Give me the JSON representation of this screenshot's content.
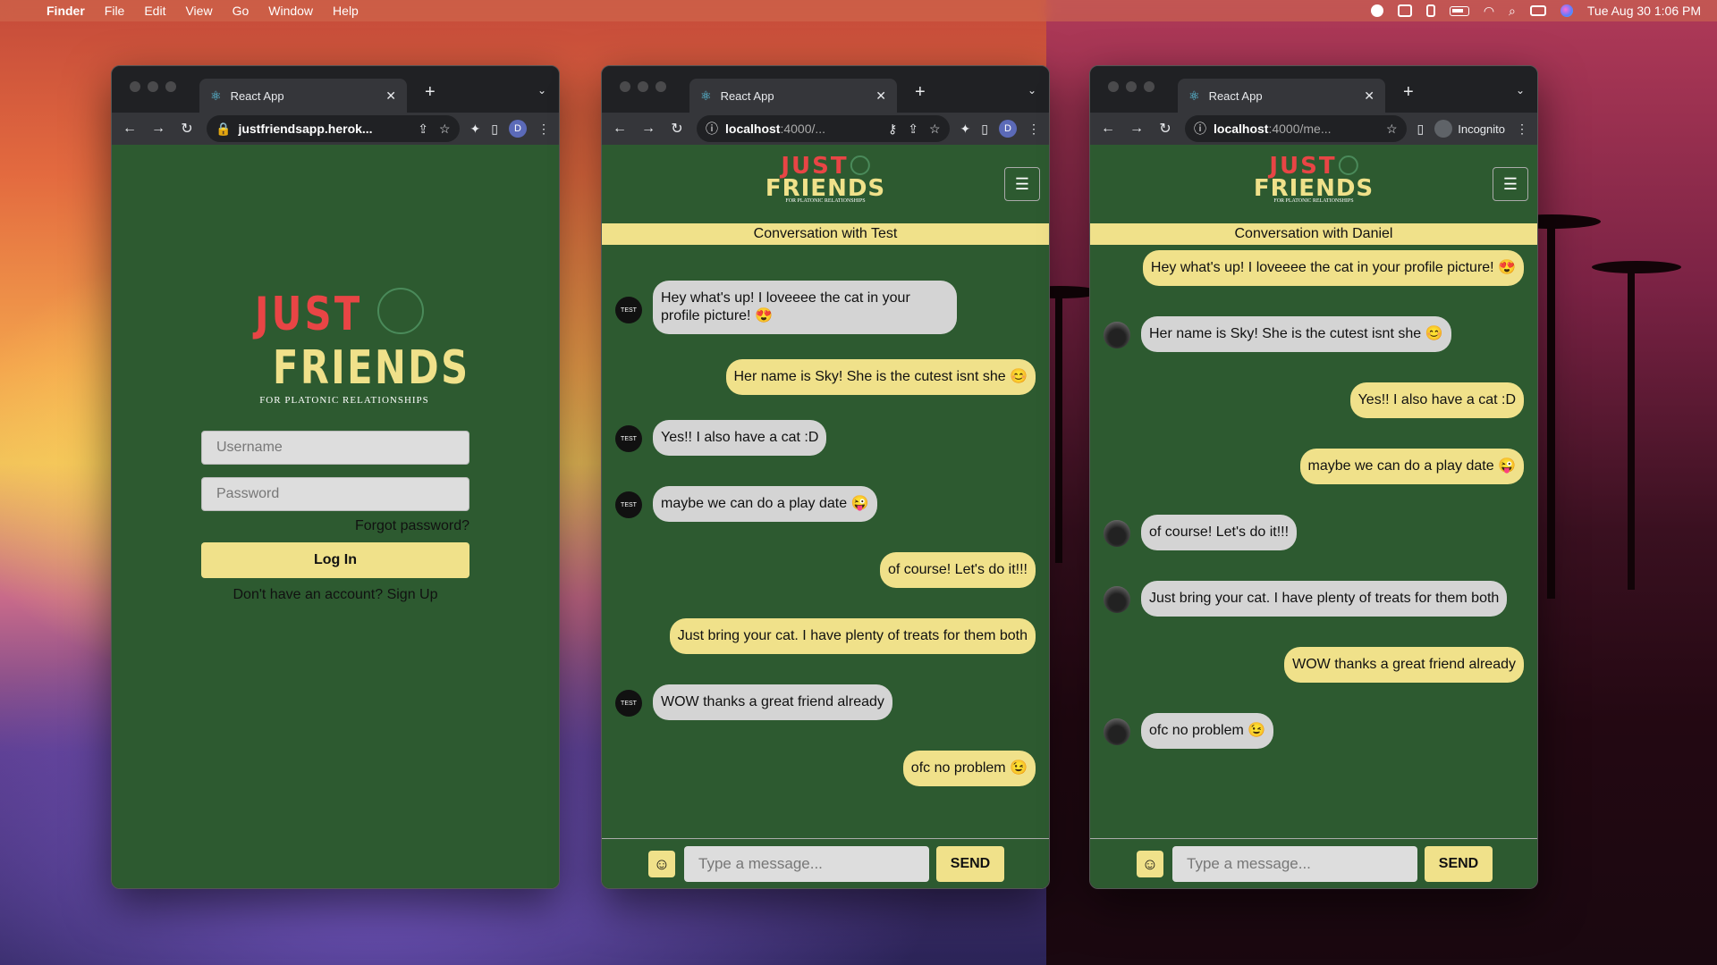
{
  "menubar": {
    "app": "Finder",
    "menus": [
      "File",
      "Edit",
      "View",
      "Go",
      "Window",
      "Help"
    ],
    "datetime": "Tue Aug 30  1:06 PM"
  },
  "windows": [
    {
      "tab_title": "React App",
      "url_host": "justfriendsapp.herok...",
      "url_path": "",
      "profile_initial": "D"
    },
    {
      "tab_title": "React App",
      "url_host": "localhost",
      "url_path": ":4000/...",
      "profile_initial": "D"
    },
    {
      "tab_title": "React App",
      "url_host": "localhost",
      "url_path": ":4000/me...",
      "incognito_label": "Incognito"
    }
  ],
  "logo": {
    "just": "JUST",
    "friends": "FRIENDS",
    "tagline": "FOR PLATONIC RELATIONSHIPS"
  },
  "login": {
    "username_placeholder": "Username",
    "password_placeholder": "Password",
    "forgot": "Forgot password?",
    "login_button": "Log In",
    "signup": "Don't have an account? Sign Up"
  },
  "chat_test": {
    "title": "Conversation with Test",
    "avatar_label": "TEST",
    "messages": [
      "Hey what's up! I loveeee the cat in your profile picture! 😍",
      "Her name is Sky! She is the cutest isnt she 😊",
      "Yes!! I also have a cat :D",
      "maybe we can do a play date 😜",
      "of course! Let's do it!!!",
      "Just bring your cat. I have plenty of treats for them both",
      "WOW thanks a great friend already",
      "ofc no problem 😉"
    ],
    "input_placeholder": "Type a message...",
    "send": "SEND"
  },
  "chat_daniel": {
    "title": "Conversation with Daniel",
    "messages": [
      "Hey what's up! I loveeee the cat in your profile picture! 😍",
      "Her name is Sky! She is the cutest isnt she 😊",
      "Yes!! I also have a cat :D",
      "maybe we can do a play date 😜",
      "of course! Let's do it!!!",
      "Just bring your cat. I have plenty of treats for them both",
      "WOW thanks a great friend already",
      "ofc no problem 😉"
    ],
    "input_placeholder": "Type a message...",
    "send": "SEND"
  }
}
